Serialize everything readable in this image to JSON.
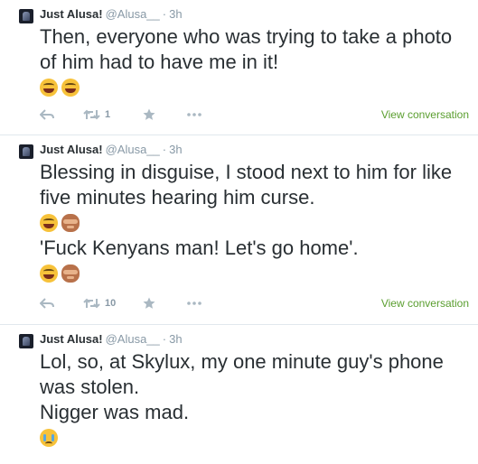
{
  "tweets": [
    {
      "name": "Just Alusa!",
      "handle": "@Alusa__",
      "separator": "·",
      "time": "3h",
      "lines": [
        "Then, everyone who was trying to take a photo of him had to have me in it!"
      ],
      "emoji_line_1": [
        "face-with-tears-of-joy",
        "face-with-tears-of-joy"
      ],
      "retweet_count": "1",
      "view_link": "View conversation"
    },
    {
      "name": "Just Alusa!",
      "handle": "@Alusa__",
      "separator": "·",
      "time": "3h",
      "line_1": "Blessing in disguise, I stood next to him for like five minutes hearing him curse.",
      "emoji_line_1": [
        "face-with-tears-of-joy",
        "see-no-evil-monkey"
      ],
      "line_2": "'Fuck Kenyans man! Let's go home'.",
      "emoji_line_2": [
        "face-with-tears-of-joy",
        "see-no-evil-monkey"
      ],
      "retweet_count": "10",
      "view_link": "View conversation"
    },
    {
      "name": "Just Alusa!",
      "handle": "@Alusa__",
      "separator": "·",
      "time": "3h",
      "line_1": "Lol, so, at Skylux, my one minute guy's phone was stolen.",
      "line_2": "Nigger was mad.",
      "emoji_line_1": [
        "crying-face"
      ]
    }
  ],
  "colors": {
    "text": "#292f33",
    "meta": "#8899a6",
    "icon": "#aab8c2",
    "link": "#5a9e2f",
    "divider": "#e1e8ed"
  }
}
